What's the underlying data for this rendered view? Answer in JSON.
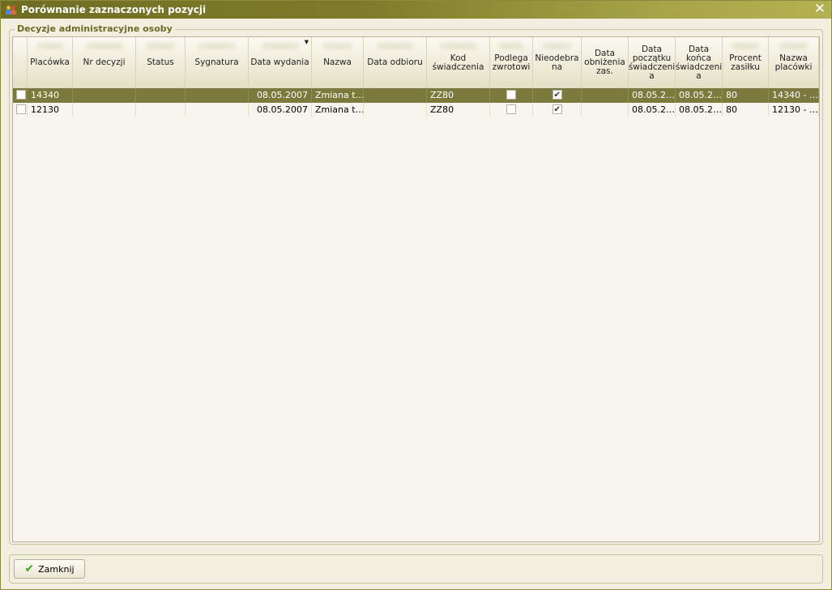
{
  "window": {
    "title": "Porównanie zaznaczonych pozycji",
    "icon": "people-icon"
  },
  "group": {
    "legend": "Decyzje administracyjne osoby"
  },
  "grid": {
    "columns": [
      "",
      "Placówka",
      "Nr decyzji",
      "Status",
      "Sygnatura",
      "Data wydania",
      "Nazwa",
      "Data odbioru",
      "Kod świadczenia",
      "Podlega zwrotowi",
      "Nieodebra na",
      "Data obniżenia zas.",
      "Data początku świadczeni a",
      "Data końca świadczeni a",
      "Procent zasiłku",
      "Nazwa placówki"
    ],
    "sorted_column": "Data wydania",
    "rows": [
      {
        "selected": true,
        "checked": false,
        "placowka": "14340",
        "nr_decyzji": "",
        "status": "",
        "sygnatura": "",
        "data_wydania": "08.05.2007",
        "nazwa": "Zmiana t…",
        "data_odbioru": "",
        "kod": "ZZ80",
        "podlega": false,
        "nieodebrana": true,
        "data_obnizenia": "",
        "data_poczatku": "08.05.2…",
        "data_konca": "08.05.2…",
        "procent": "80",
        "nazwa_placowki": "14340 - …"
      },
      {
        "selected": false,
        "checked": false,
        "placowka": "12130",
        "nr_decyzji": "",
        "status": "",
        "sygnatura": "",
        "data_wydania": "08.05.2007",
        "nazwa": "Zmiana t…",
        "data_odbioru": "",
        "kod": "ZZ80",
        "podlega": false,
        "nieodebrana": true,
        "data_obnizenia": "",
        "data_poczatku": "08.05.2…",
        "data_konca": "08.05.2…",
        "procent": "80",
        "nazwa_placowki": "12130 - …"
      }
    ]
  },
  "footer": {
    "close_label": "Zamknij",
    "close_icon": "checkmark-icon"
  },
  "colors": {
    "titlebar": "#7f7d2b",
    "selected_row": "#7b7a3c",
    "legend_text": "#6b6a24",
    "check_green": "#3fa62a"
  }
}
